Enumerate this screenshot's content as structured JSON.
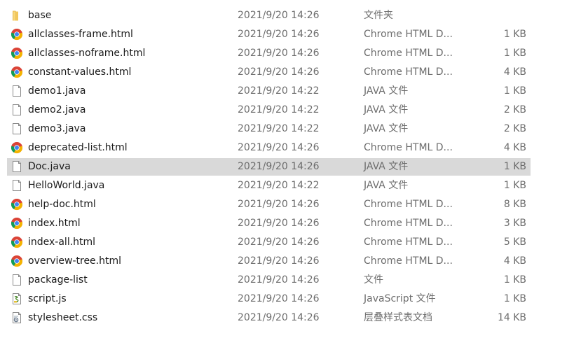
{
  "files": [
    {
      "name": "base",
      "date": "2021/9/20 14:26",
      "type": "文件夹",
      "size": "",
      "icon": "folder-icon"
    },
    {
      "name": "allclasses-frame.html",
      "date": "2021/9/20 14:26",
      "type": "Chrome HTML D...",
      "size": "1 KB",
      "icon": "chrome-icon"
    },
    {
      "name": "allclasses-noframe.html",
      "date": "2021/9/20 14:26",
      "type": "Chrome HTML D...",
      "size": "1 KB",
      "icon": "chrome-icon"
    },
    {
      "name": "constant-values.html",
      "date": "2021/9/20 14:26",
      "type": "Chrome HTML D...",
      "size": "4 KB",
      "icon": "chrome-icon"
    },
    {
      "name": "demo1.java",
      "date": "2021/9/20 14:22",
      "type": "JAVA 文件",
      "size": "1 KB",
      "icon": "file-icon"
    },
    {
      "name": "demo2.java",
      "date": "2021/9/20 14:22",
      "type": "JAVA 文件",
      "size": "2 KB",
      "icon": "file-icon"
    },
    {
      "name": "demo3.java",
      "date": "2021/9/20 14:22",
      "type": "JAVA 文件",
      "size": "2 KB",
      "icon": "file-icon"
    },
    {
      "name": "deprecated-list.html",
      "date": "2021/9/20 14:26",
      "type": "Chrome HTML D...",
      "size": "4 KB",
      "icon": "chrome-icon"
    },
    {
      "name": "Doc.java",
      "date": "2021/9/20 14:26",
      "type": "JAVA 文件",
      "size": "1 KB",
      "icon": "file-icon",
      "selected": true
    },
    {
      "name": "HelloWorld.java",
      "date": "2021/9/20 14:22",
      "type": "JAVA 文件",
      "size": "1 KB",
      "icon": "file-icon"
    },
    {
      "name": "help-doc.html",
      "date": "2021/9/20 14:26",
      "type": "Chrome HTML D...",
      "size": "8 KB",
      "icon": "chrome-icon"
    },
    {
      "name": "index.html",
      "date": "2021/9/20 14:26",
      "type": "Chrome HTML D...",
      "size": "3 KB",
      "icon": "chrome-icon"
    },
    {
      "name": "index-all.html",
      "date": "2021/9/20 14:26",
      "type": "Chrome HTML D...",
      "size": "5 KB",
      "icon": "chrome-icon"
    },
    {
      "name": "overview-tree.html",
      "date": "2021/9/20 14:26",
      "type": "Chrome HTML D...",
      "size": "4 KB",
      "icon": "chrome-icon"
    },
    {
      "name": "package-list",
      "date": "2021/9/20 14:26",
      "type": "文件",
      "size": "1 KB",
      "icon": "file-icon"
    },
    {
      "name": "script.js",
      "date": "2021/9/20 14:26",
      "type": "JavaScript 文件",
      "size": "1 KB",
      "icon": "script-file-icon"
    },
    {
      "name": "stylesheet.css",
      "date": "2021/9/20 14:26",
      "type": "层叠样式表文档",
      "size": "14 KB",
      "icon": "css-file-icon"
    }
  ]
}
